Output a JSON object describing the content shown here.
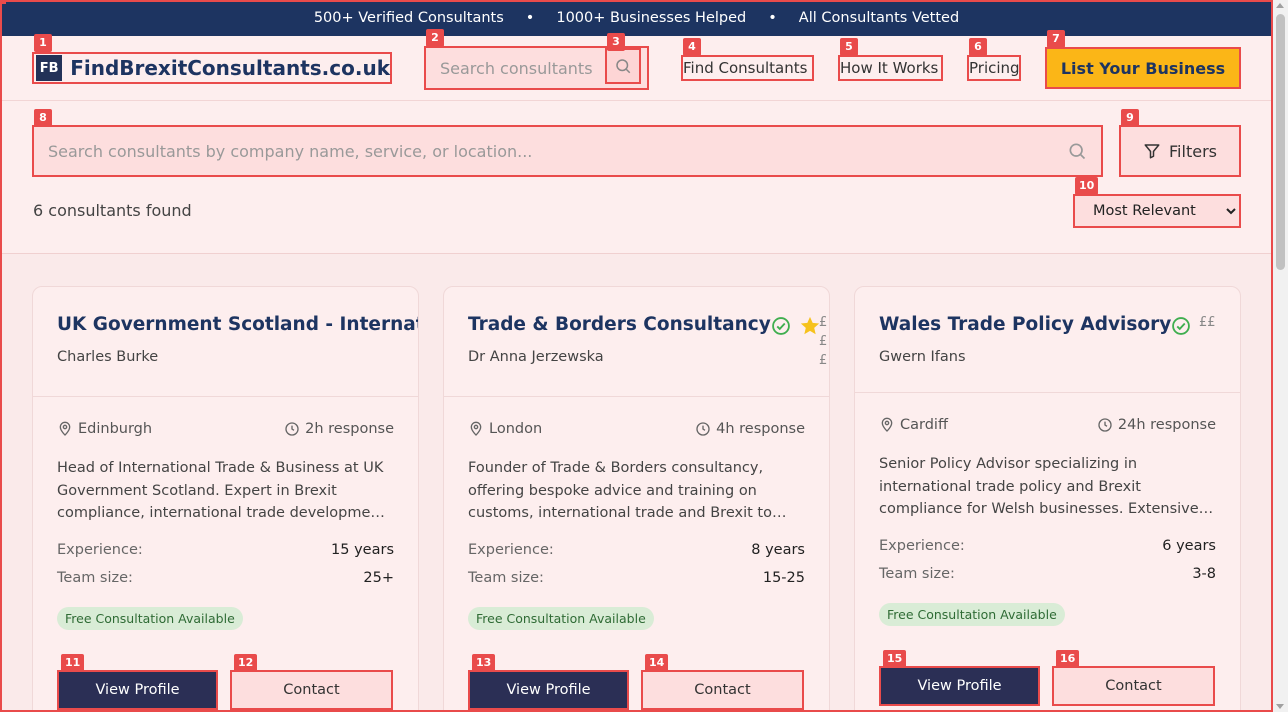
{
  "banner": {
    "items": [
      "500+ Verified Consultants",
      "1000+ Businesses Helped",
      "All Consultants Vetted"
    ],
    "separator": "•"
  },
  "header": {
    "logo_mark": "FB",
    "logo_text": "FindBrexitConsultants.co.uk",
    "search_placeholder": "Search consultants",
    "nav": [
      "Find Consultants",
      "How It Works",
      "Pricing"
    ],
    "cta": "List Your Business"
  },
  "search": {
    "placeholder": "Search consultants by company name, service, or location...",
    "filters_label": "Filters",
    "results_text": "6 consultants found",
    "sort_options": [
      "Most Relevant"
    ],
    "sort_selected": "Most Relevant"
  },
  "labels": {
    "badges": [
      "1",
      "2",
      "3",
      "4",
      "5",
      "6",
      "7",
      "8",
      "9",
      "10",
      "11",
      "12",
      "13",
      "14",
      "15",
      "16"
    ],
    "experience": "Experience:",
    "team_size": "Team size:",
    "free_consultation": "Free Consultation Available",
    "view_profile": "View Profile",
    "contact": "Contact"
  },
  "consultants": [
    {
      "title": "UK Government Scotland - International",
      "person": "Charles Burke",
      "location": "Edinburgh",
      "response": "2h response",
      "description": "Head of International Trade & Business at UK Government Scotland. Expert in Brexit compliance, international trade development, and export support for Scottish businesses.",
      "experience": "15 years",
      "team_size": "25+"
    },
    {
      "title": "Trade & Borders Consultancy",
      "person": "Dr Anna Jerzewska",
      "location": "London",
      "response": "4h response",
      "description": "Founder of Trade & Borders consultancy, offering bespoke advice and training on customs, international trade and Brexit to businesses and governments.",
      "experience": "8 years",
      "team_size": "15-25",
      "price": "£\n£\n£"
    },
    {
      "title": "Wales Trade Policy Advisory",
      "person": "Gwern Ifans",
      "location": "Cardiff",
      "response": "24h response",
      "description": "Senior Policy Advisor specializing in international trade policy and Brexit compliance for Welsh businesses. Extensive experience supporting exporters.",
      "experience": "6 years",
      "team_size": "3-8",
      "price": "££"
    }
  ],
  "colors": {
    "navy": "#1d3461",
    "accent": "#fbb617",
    "highlight": "#e94b4b",
    "verified": "#3fae4f",
    "star": "#f6c21c"
  }
}
